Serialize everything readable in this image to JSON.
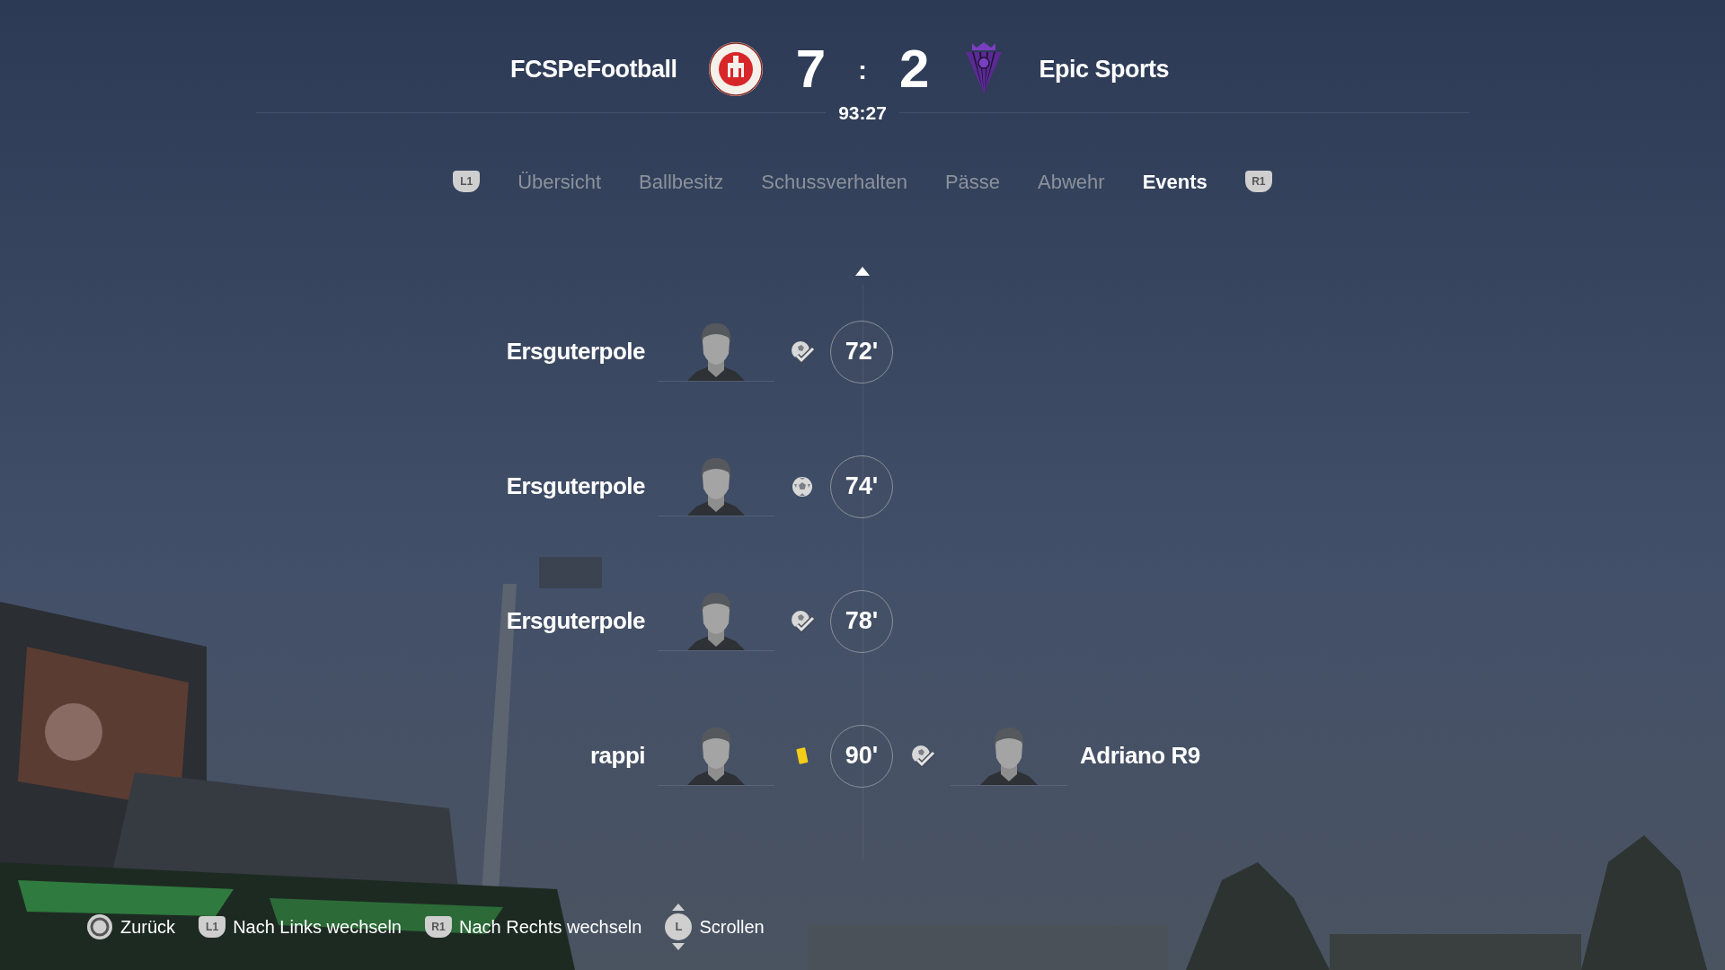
{
  "header": {
    "home_team": "FCSPeFootball",
    "home_score": "7",
    "separator": ":",
    "away_score": "2",
    "away_team": "Epic Sports",
    "clock": "93:27"
  },
  "tabs": {
    "prev_button": "L1",
    "next_button": "R1",
    "items": [
      {
        "label": "Übersicht",
        "selected": false
      },
      {
        "label": "Ballbesitz",
        "selected": false
      },
      {
        "label": "Schussverhalten",
        "selected": false
      },
      {
        "label": "Pässe",
        "selected": false
      },
      {
        "label": "Abwehr",
        "selected": false
      },
      {
        "label": "Events",
        "selected": true
      }
    ]
  },
  "events": [
    {
      "minute": "72'",
      "home": {
        "player": "Ersguterpole",
        "kind": "assist"
      }
    },
    {
      "minute": "74'",
      "home": {
        "player": "Ersguterpole",
        "kind": "goal"
      }
    },
    {
      "minute": "78'",
      "home": {
        "player": "Ersguterpole",
        "kind": "assist"
      }
    },
    {
      "minute": "90'",
      "home": {
        "player": "rappi",
        "kind": "yellow_card"
      },
      "away": {
        "player": "Adriano R9",
        "kind": "assist"
      }
    }
  ],
  "footer": [
    {
      "kind": "circle",
      "label": "Zurück"
    },
    {
      "kind": "badge",
      "badge": "L1",
      "label": "Nach Links wechseln"
    },
    {
      "kind": "badge",
      "badge": "R1",
      "label": "Nach Rechts wechseln"
    },
    {
      "kind": "stick",
      "badge": "L",
      "label": "Scrollen"
    }
  ]
}
